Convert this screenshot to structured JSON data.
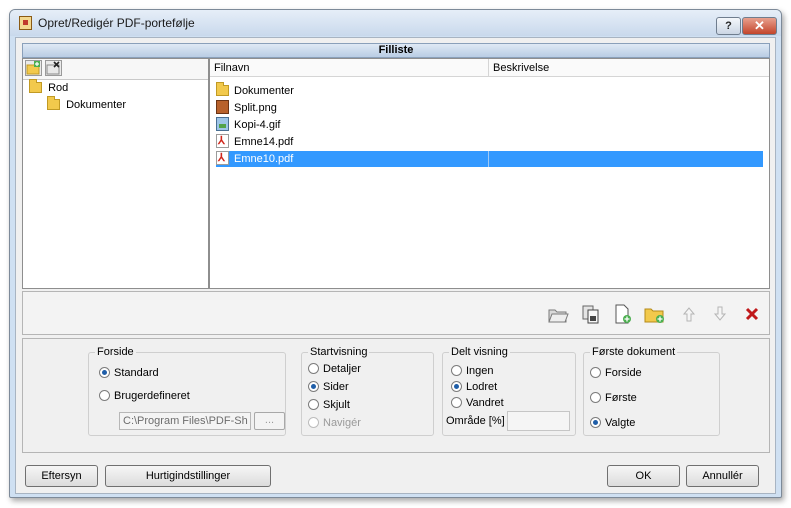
{
  "window": {
    "title": "Opret/Redigér PDF-portefølje",
    "help_label": "?",
    "close_label": "✕"
  },
  "header": {
    "title": "Filliste"
  },
  "tree": {
    "items": [
      {
        "label": "Rod"
      },
      {
        "label": "Dokumenter"
      }
    ]
  },
  "file_list": {
    "columns": [
      "Filnavn",
      "Beskrivelse"
    ],
    "rows": [
      {
        "name": "Dokumenter",
        "description": "",
        "type": "folder"
      },
      {
        "name": "Split.png",
        "description": "",
        "type": "png"
      },
      {
        "name": "Kopi-4.gif",
        "description": "",
        "type": "gif"
      },
      {
        "name": "Emne14.pdf",
        "description": "",
        "type": "pdf"
      },
      {
        "name": "Emne10.pdf",
        "description": "",
        "type": "pdf",
        "selected": true
      }
    ]
  },
  "forside": {
    "title": "Forside",
    "options": [
      "Standard",
      "Brugerdefineret"
    ],
    "selected": "Standard",
    "path_value": "C:\\Program Files\\PDF-Sh",
    "browse_label": "..."
  },
  "startvisning": {
    "title": "Startvisning",
    "options": [
      "Detaljer",
      "Sider",
      "Skjult",
      "Navigér"
    ],
    "selected": "Sider",
    "disabled": [
      "Navigér"
    ]
  },
  "delt_visning": {
    "title": "Delt visning",
    "options": [
      "Ingen",
      "Lodret",
      "Vandret"
    ],
    "selected": "Lodret",
    "area_label": "Område [%]",
    "area_value": ""
  },
  "foerste_dokument": {
    "title": "Første dokument",
    "options": [
      "Forside",
      "Første",
      "Valgte"
    ],
    "selected": "Valgte"
  },
  "buttons": {
    "preview": "Eftersyn",
    "quick_settings": "Hurtigindstillinger",
    "ok": "OK",
    "cancel": "Annullér"
  },
  "colors": {
    "selection": "#3399ff",
    "delete_icon": "#c0181a",
    "folder": "#f2c94c"
  }
}
